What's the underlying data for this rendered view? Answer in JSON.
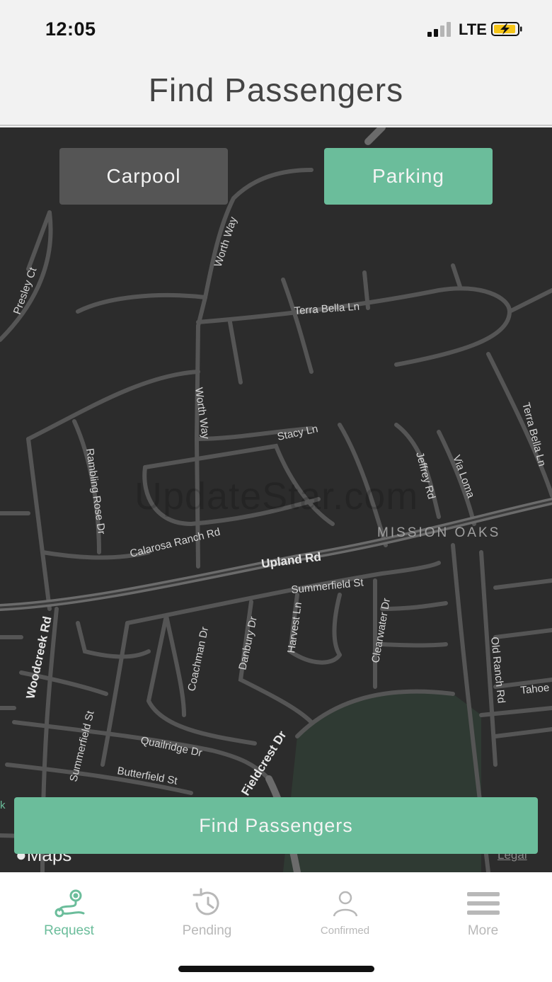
{
  "status": {
    "time": "12:05",
    "network": "LTE"
  },
  "header": {
    "title": "Find Passengers"
  },
  "map": {
    "watermark": "UpdateStar.com",
    "area_label": "MISSION OAKS",
    "brand": "Maps",
    "legal": "Legal",
    "roads": {
      "presley": "Presley Ct",
      "worth_way_top": "Worth Way",
      "terra_bella_ln": "Terra Bella Ln",
      "worth_way_mid": "Worth Way",
      "stacy": "Stacy Ln",
      "rambling": "Rambling Rose Dr",
      "jeffrey": "Jeffrey Rd",
      "via_loma": "Via Loma",
      "terra_bella_right": "Terra Bella Ln",
      "calarosa": "Calarosa Ranch Rd",
      "upland": "Upland Rd",
      "summerfield_top": "Summerfield St",
      "woodcreek": "Woodcreek Rd",
      "coachman": "Coachman Dr",
      "danbury": "Danbury Dr",
      "harvest": "Harvest Ln",
      "clearwater": "Clearwater Dr",
      "old_ranch": "Old Ranch Rd",
      "tahoe": "Tahoe",
      "summerfield_left": "Summerfield St",
      "qualridge": "Quailridge Dr",
      "butterfield": "Butterfield St",
      "fieldcrest": "Fieldcrest Dr",
      "edge_left": "k"
    }
  },
  "toggle": {
    "carpool_label": "Carpool",
    "parking_label": "Parking"
  },
  "actions": {
    "find_label": "Find Passengers"
  },
  "tabs": [
    {
      "label": "Request",
      "icon": "route-icon",
      "active": true
    },
    {
      "label": "Pending",
      "icon": "history-icon",
      "active": false
    },
    {
      "label": "Confirmed",
      "icon": "person-icon",
      "active": false
    },
    {
      "label": "More",
      "icon": "menu-icon",
      "active": false
    }
  ],
  "colors": {
    "accent": "#6bbd9b",
    "map_bg": "#2c2c2c",
    "inactive_button": "#555555"
  }
}
